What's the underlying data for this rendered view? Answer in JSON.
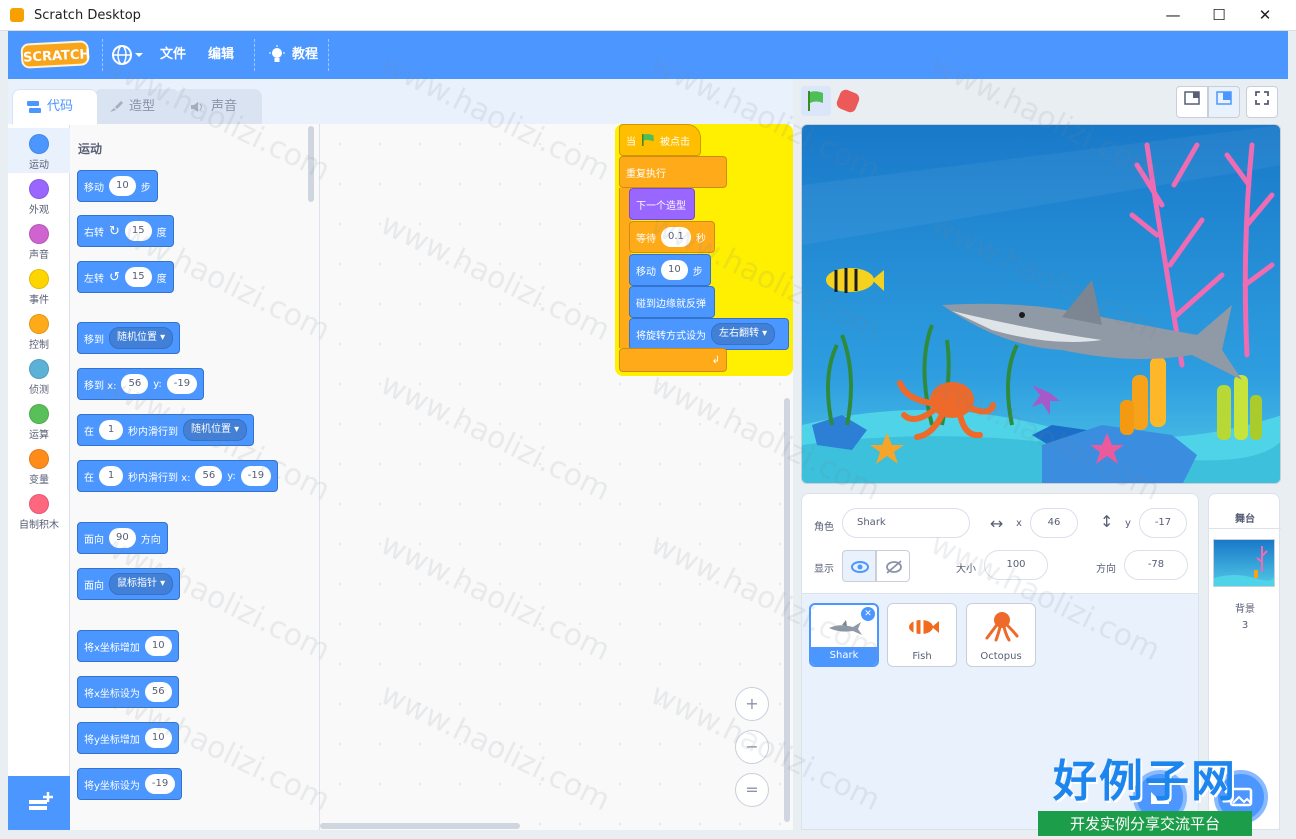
{
  "window": {
    "title": "Scratch Desktop",
    "controls": [
      "—",
      "☐",
      "✕"
    ]
  },
  "menu": {
    "logo": "SCRATCH",
    "file": "文件",
    "edit": "编辑",
    "tutorials": "教程"
  },
  "tabs": [
    {
      "label": "代码"
    },
    {
      "label": "造型"
    },
    {
      "label": "声音"
    }
  ],
  "categories": [
    {
      "label": "运动",
      "color": "#4c97ff"
    },
    {
      "label": "外观",
      "color": "#9966ff"
    },
    {
      "label": "声音",
      "color": "#cf63cf"
    },
    {
      "label": "事件",
      "color": "#ffd500"
    },
    {
      "label": "控制",
      "color": "#ffab19"
    },
    {
      "label": "侦测",
      "color": "#5cb1d6"
    },
    {
      "label": "运算",
      "color": "#59c059"
    },
    {
      "label": "变量",
      "color": "#ff8c1a"
    },
    {
      "label": "自制积木",
      "color": "#ff6680"
    }
  ],
  "palette": {
    "heading": "运动",
    "move": {
      "a": "移动",
      "n": "10",
      "b": "步"
    },
    "turn_right": {
      "a": "右转",
      "n": "15",
      "b": "度"
    },
    "turn_left": {
      "a": "左转",
      "n": "15",
      "b": "度"
    },
    "goto": {
      "a": "移到",
      "d": "随机位置"
    },
    "goto_xy": {
      "a": "移到 x:",
      "x": "56",
      "yl": "y:",
      "y": "-19"
    },
    "glide": {
      "a": "在",
      "n": "1",
      "b": "秒内滑行到",
      "d": "随机位置"
    },
    "glide_xy": {
      "a": "在",
      "n": "1",
      "b": "秒内滑行到 x:",
      "x": "56",
      "yl": "y:",
      "y": "-19"
    },
    "point_dir": {
      "a": "面向",
      "n": "90",
      "b": "方向"
    },
    "point_towards": {
      "a": "面向",
      "d": "鼠标指针"
    },
    "change_x": {
      "a": "将x坐标增加",
      "n": "10"
    },
    "set_x": {
      "a": "将x坐标设为",
      "n": "56"
    },
    "change_y": {
      "a": "将y坐标增加",
      "n": "10"
    },
    "set_y": {
      "a": "将y坐标设为",
      "n": "-19"
    }
  },
  "script": {
    "hat": {
      "a": "当",
      "b": "被点击"
    },
    "forever": "重复执行",
    "next_costume": "下一个造型",
    "wait": {
      "a": "等待",
      "n": "0.1",
      "b": "秒"
    },
    "move": {
      "a": "移动",
      "n": "10",
      "b": "步"
    },
    "bounce": "碰到边缘就反弹",
    "rotation": {
      "a": "将旋转方式设为",
      "d": "左右翻转"
    }
  },
  "zoom": {
    "in": "+",
    "out": "−",
    "reset": "="
  },
  "sprite_info": {
    "sprite_label": "角色",
    "sprite_name": "Shark",
    "x_label": "x",
    "x": "46",
    "y_label": "y",
    "y": "-17",
    "show_label": "显示",
    "size_label": "大小",
    "size": "100",
    "direction_label": "方向",
    "direction": "-78"
  },
  "sprites": [
    {
      "name": "Shark"
    },
    {
      "name": "Fish"
    },
    {
      "name": "Octopus"
    }
  ],
  "stage_panel": {
    "title": "舞台",
    "backdrops_label": "背景",
    "backdrops_count": "3"
  },
  "watermark": "www.haolizi.com",
  "brand": {
    "big": "好例子网",
    "small": "开发实例分享交流平台"
  },
  "colors": {
    "accent": "#4c97ff",
    "motion": "#4c97ff",
    "looks": "#9966ff",
    "control": "#ffab19",
    "events": "#ffbf00"
  }
}
